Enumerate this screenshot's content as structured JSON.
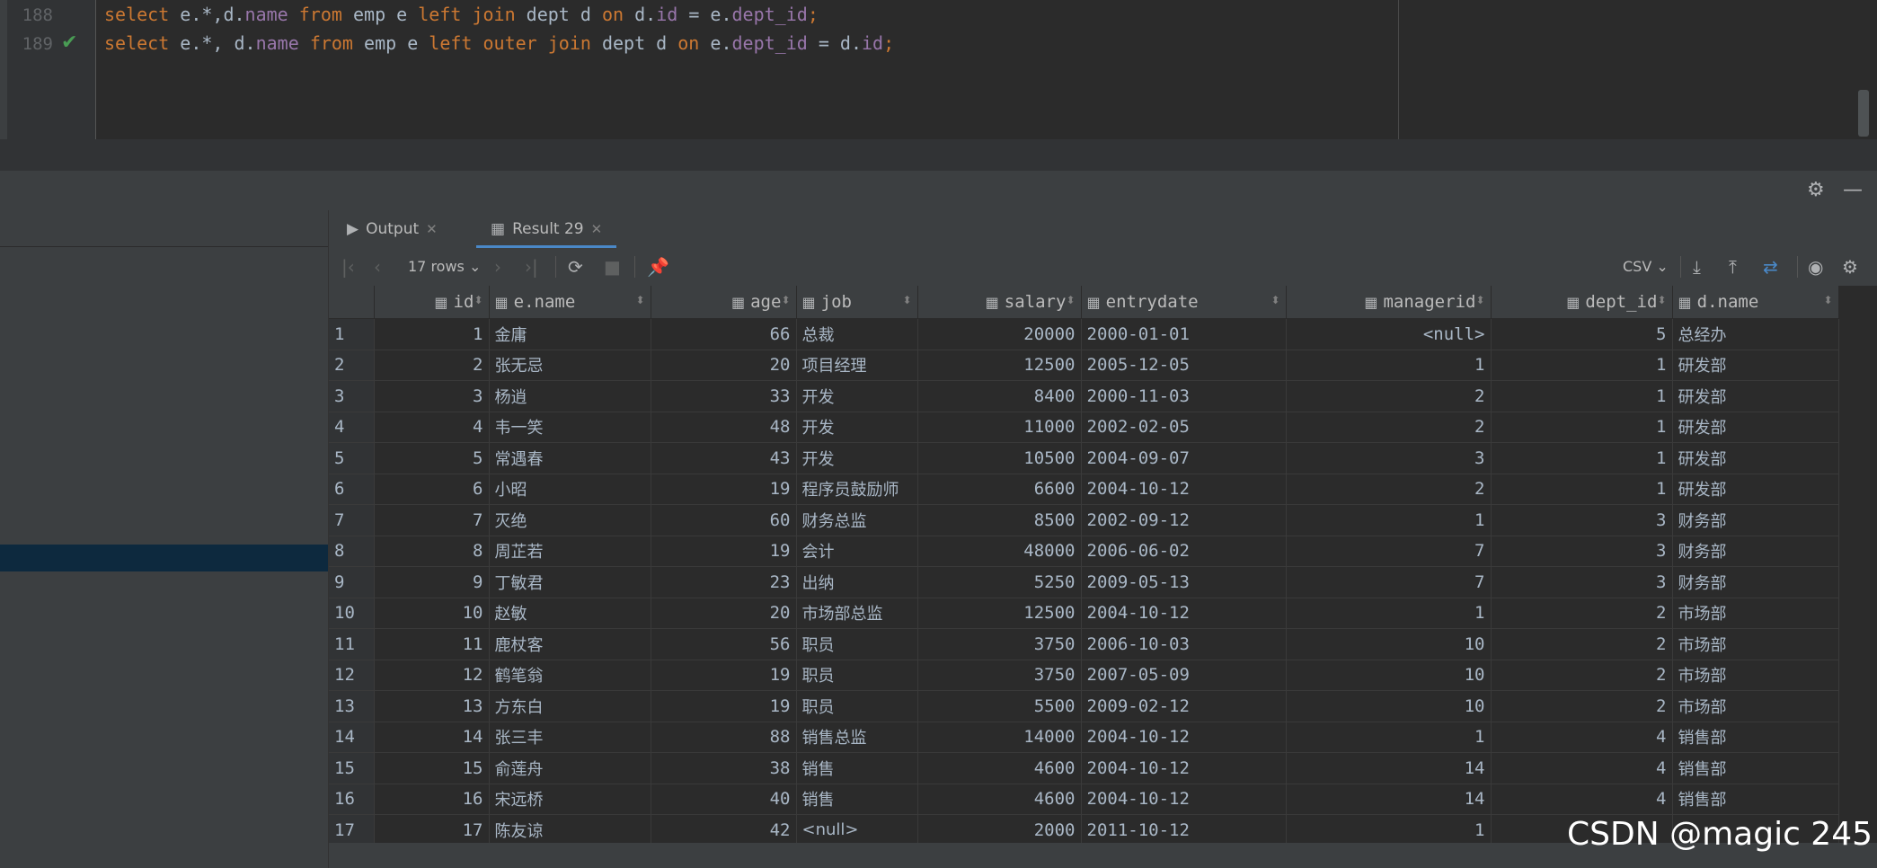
{
  "editor": {
    "lines": [
      {
        "num": "188",
        "has_check": false
      },
      {
        "num": "189",
        "has_check": true
      }
    ]
  },
  "tabs": [
    {
      "label": "Output",
      "icon": "console-icon",
      "active": false
    },
    {
      "label": "Result 29",
      "icon": "table-icon",
      "active": true
    }
  ],
  "toolbar": {
    "rows_label": "17 rows",
    "export_format": "CSV"
  },
  "grid": {
    "columns": [
      "id",
      "e.name",
      "age",
      "job",
      "salary",
      "entrydate",
      "managerid",
      "dept_id",
      "d.name"
    ],
    "rows": [
      [
        "1",
        "1",
        "金庸",
        "66",
        "总裁",
        "20000",
        "2000-01-01",
        "<null>",
        "5",
        "总经办"
      ],
      [
        "2",
        "2",
        "张无忌",
        "20",
        "项目经理",
        "12500",
        "2005-12-05",
        "1",
        "1",
        "研发部"
      ],
      [
        "3",
        "3",
        "杨逍",
        "33",
        "开发",
        "8400",
        "2000-11-03",
        "2",
        "1",
        "研发部"
      ],
      [
        "4",
        "4",
        "韦一笑",
        "48",
        "开发",
        "11000",
        "2002-02-05",
        "2",
        "1",
        "研发部"
      ],
      [
        "5",
        "5",
        "常遇春",
        "43",
        "开发",
        "10500",
        "2004-09-07",
        "3",
        "1",
        "研发部"
      ],
      [
        "6",
        "6",
        "小昭",
        "19",
        "程序员鼓励师",
        "6600",
        "2004-10-12",
        "2",
        "1",
        "研发部"
      ],
      [
        "7",
        "7",
        "灭绝",
        "60",
        "财务总监",
        "8500",
        "2002-09-12",
        "1",
        "3",
        "财务部"
      ],
      [
        "8",
        "8",
        "周芷若",
        "19",
        "会计",
        "48000",
        "2006-06-02",
        "7",
        "3",
        "财务部"
      ],
      [
        "9",
        "9",
        "丁敏君",
        "23",
        "出纳",
        "5250",
        "2009-05-13",
        "7",
        "3",
        "财务部"
      ],
      [
        "10",
        "10",
        "赵敏",
        "20",
        "市场部总监",
        "12500",
        "2004-10-12",
        "1",
        "2",
        "市场部"
      ],
      [
        "11",
        "11",
        "鹿杖客",
        "56",
        "职员",
        "3750",
        "2006-10-03",
        "10",
        "2",
        "市场部"
      ],
      [
        "12",
        "12",
        "鹤笔翁",
        "19",
        "职员",
        "3750",
        "2007-05-09",
        "10",
        "2",
        "市场部"
      ],
      [
        "13",
        "13",
        "方东白",
        "19",
        "职员",
        "5500",
        "2009-02-12",
        "10",
        "2",
        "市场部"
      ],
      [
        "14",
        "14",
        "张三丰",
        "88",
        "销售总监",
        "14000",
        "2004-10-12",
        "1",
        "4",
        "销售部"
      ],
      [
        "15",
        "15",
        "俞莲舟",
        "38",
        "销售",
        "4600",
        "2004-10-12",
        "14",
        "4",
        "销售部"
      ],
      [
        "16",
        "16",
        "宋远桥",
        "40",
        "销售",
        "4600",
        "2004-10-12",
        "14",
        "4",
        "销售部"
      ],
      [
        "17",
        "17",
        "陈友谅",
        "42",
        "<null>",
        "2000",
        "2011-10-12",
        "1",
        "",
        ""
      ]
    ]
  },
  "watermark": "CSDN @magic 245"
}
